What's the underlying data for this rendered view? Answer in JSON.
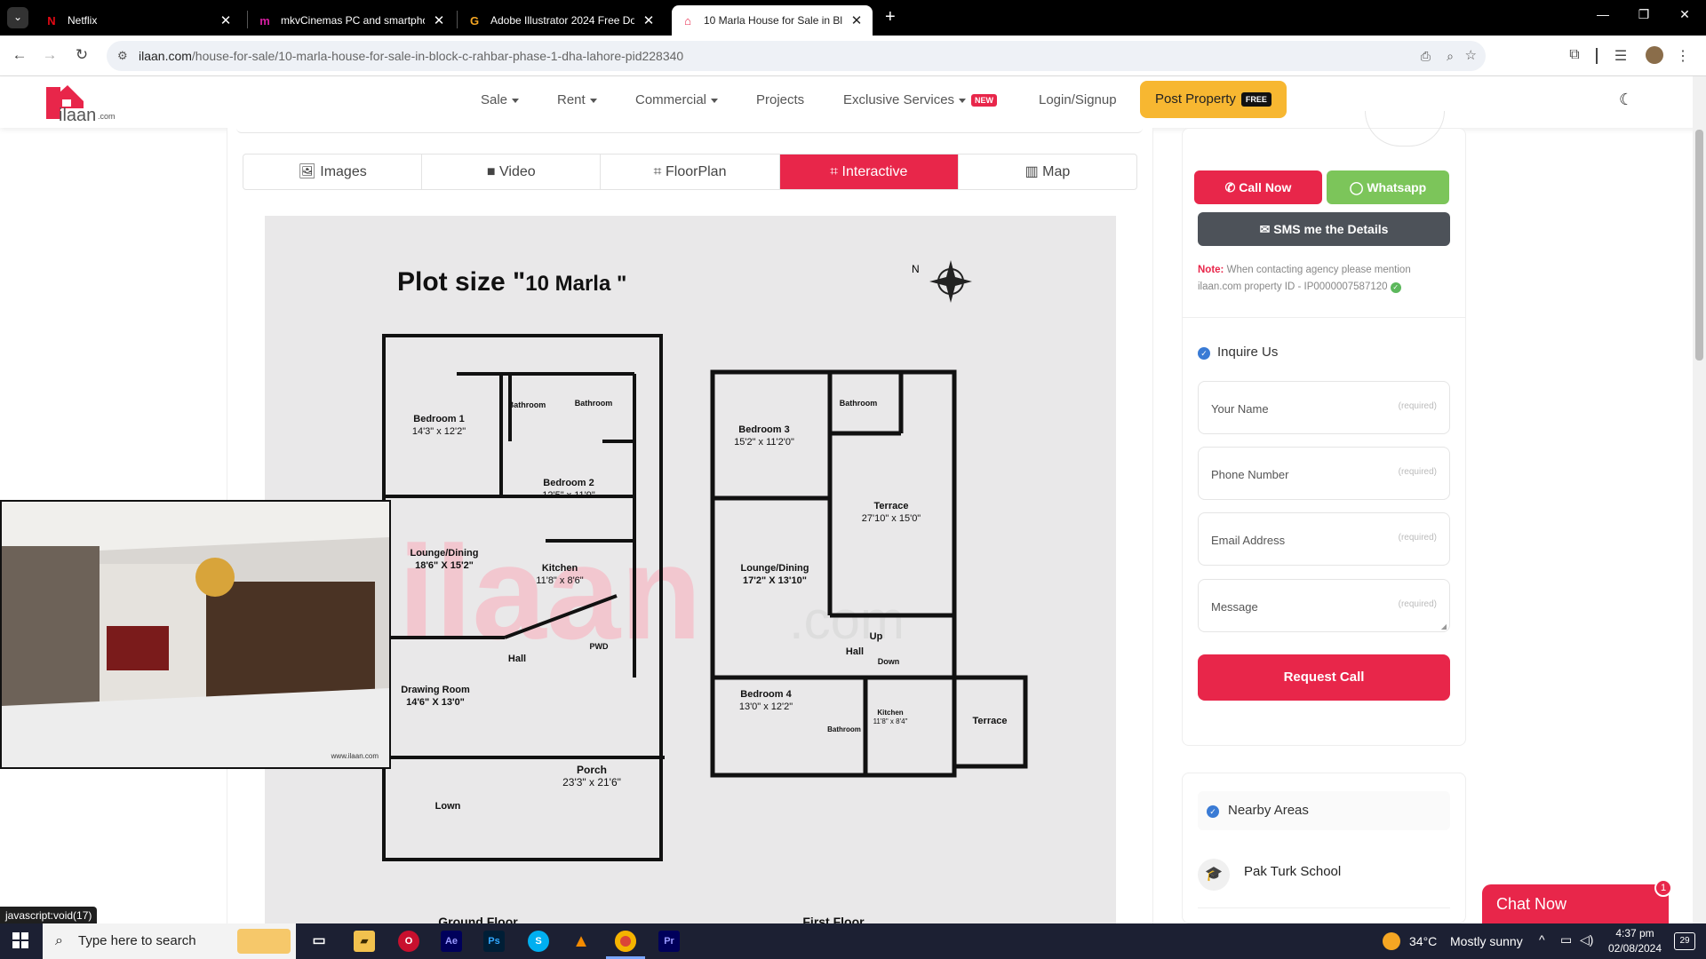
{
  "browser": {
    "tabs": [
      {
        "title": "Netflix",
        "icon": "netflix-icon",
        "active": false
      },
      {
        "title": "mkvCinemas PC and smartphon",
        "icon": "mkvcinemas-icon",
        "active": false
      },
      {
        "title": "Adobe Illustrator 2024 Free Do",
        "icon": "getintopc-icon",
        "active": false
      },
      {
        "title": "10 Marla House for Sale in Bloc",
        "icon": "ilaan-icon",
        "active": true
      }
    ],
    "url_domain": "ilaan.com",
    "url_path": "/house-for-sale/10-marla-house-for-sale-in-block-c-rahbar-phase-1-dha-lahore-pid228340"
  },
  "site": {
    "logo_text": ".com",
    "nav": {
      "sale": "Sale",
      "rent": "Rent",
      "commercial": "Commercial",
      "projects": "Projects",
      "exclusive": "Exclusive Services",
      "new_badge": "NEW",
      "login": "Login/Signup",
      "post_property": "Post Property",
      "free_badge": "FREE"
    }
  },
  "media_tabs": [
    {
      "label": "Images",
      "icon": "image-icon"
    },
    {
      "label": "Video",
      "icon": "video-icon"
    },
    {
      "label": "FloorPlan",
      "icon": "floorplan-icon"
    },
    {
      "label": "Interactive",
      "icon": "interactive-icon",
      "active": true
    },
    {
      "label": "Map",
      "icon": "map-icon"
    }
  ],
  "floorplan": {
    "title_prefix": "Plot size \"",
    "title_value": "10 Marla \"",
    "ground_label": "Ground Floor",
    "first_label": "First Floor",
    "watermark": "ilaan.com",
    "rooms": [
      {
        "name": "Bedroom 1",
        "size": "14'3\" x 12'2\""
      },
      {
        "name": "Bathroom",
        "size": ""
      },
      {
        "name": "Bathroom",
        "size": ""
      },
      {
        "name": "Bedroom 2",
        "size": "12'5\" x 11'9\""
      },
      {
        "name": "Lounge/Dining",
        "size": "18'6\" X 15'2\""
      },
      {
        "name": "Kitchen",
        "size": "11'8\" x 8'6\""
      },
      {
        "name": "PWD",
        "size": ""
      },
      {
        "name": "Hall",
        "size": ""
      },
      {
        "name": "Drawing Room",
        "size": "14'6\" X 13'0\""
      },
      {
        "name": "Porch",
        "size": "23'3\" x 21'6\""
      },
      {
        "name": "Lown",
        "size": ""
      },
      {
        "name": "Bedroom 3",
        "size": "15'2\" x 11'2'0\""
      },
      {
        "name": "Bathroom",
        "size": ""
      },
      {
        "name": "Terrace",
        "size": "27'10\" x 15'0\""
      },
      {
        "name": "Lounge/Dining",
        "size": "17'2\" X 13'10\""
      },
      {
        "name": "Up",
        "size": ""
      },
      {
        "name": "Hall",
        "size": ""
      },
      {
        "name": "Down",
        "size": ""
      },
      {
        "name": "Bedroom 4",
        "size": "13'0\" x 12'2\""
      },
      {
        "name": "Bathroom",
        "size": ""
      },
      {
        "name": "Kitchen",
        "size": "11'8\" x 8'4\""
      },
      {
        "name": "Terrace",
        "size": ""
      }
    ]
  },
  "pip": {
    "watermark": "www.ilaan.com"
  },
  "sidebar": {
    "call_now": "Call Now",
    "whatsapp": "Whatsapp",
    "sms": "SMS me the Details",
    "note_label": "Note:",
    "note_text": " When contacting agency please mention ilaan.com property ID - IP0000007587120",
    "inquire_title": "Inquire Us",
    "fields": [
      {
        "placeholder": "Your Name",
        "req": "(required)"
      },
      {
        "placeholder": "Phone Number",
        "req": "(required)"
      },
      {
        "placeholder": "Email Address",
        "req": "(required)"
      },
      {
        "placeholder": "Message",
        "req": "(required)"
      }
    ],
    "request_call": "Request Call",
    "nearby_title": "Nearby Areas",
    "nearby_items": [
      {
        "name": "Pak Turk School",
        "icon": "school-icon"
      }
    ]
  },
  "chat": {
    "label": "Chat Now",
    "badge": "1"
  },
  "statusbar": {
    "url": "javascript:void(17)"
  },
  "taskbar": {
    "search_placeholder": "Type here to search",
    "weather_temp": "34°C",
    "weather_desc": "Mostly sunny",
    "time": "4:37 pm",
    "date": "02/08/2024",
    "notif_count": "29"
  }
}
